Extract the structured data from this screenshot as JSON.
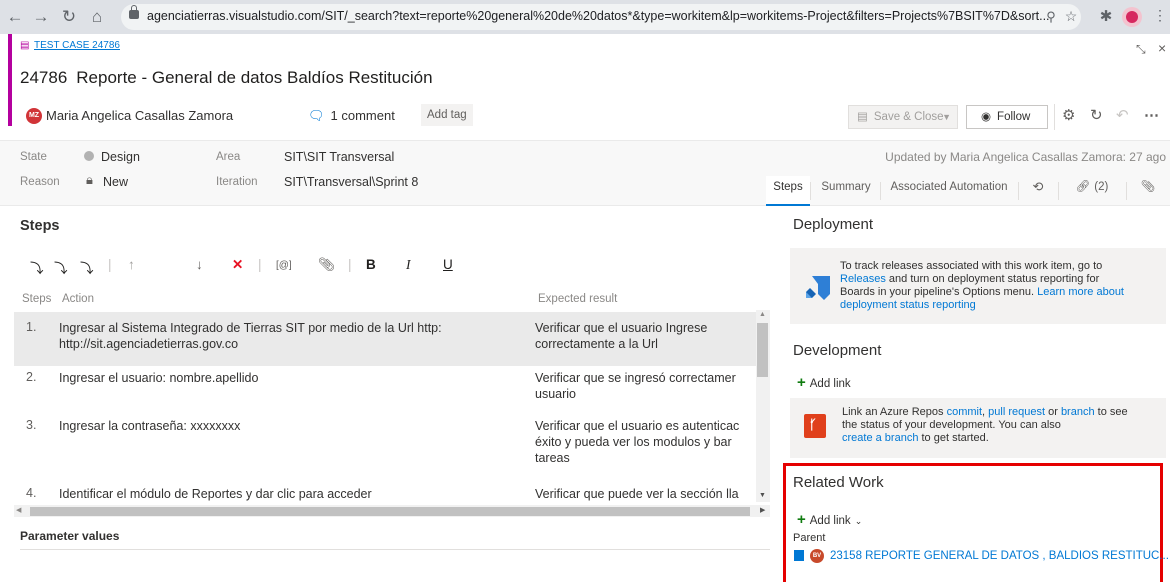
{
  "browser": {
    "url": "agenciatierras.visualstudio.com/SIT/_search?text=reporte%20general%20de%20datos*&type=workitem&lp=workitems-Project&filters=Projects%7BSIT%7D&sort..."
  },
  "workitem": {
    "breadcrumb": "TEST CASE 24786",
    "id": "24786",
    "title": "Reporte - General de datos Baldíos Restitución",
    "assignee": "Maria Angelica Casallas Zamora",
    "assignee_initials": "MZ",
    "comments": "1 comment",
    "add_tag": "Add tag"
  },
  "toolbar": {
    "save_close": "Save & Close",
    "follow": "Follow"
  },
  "fields": {
    "state_label": "State",
    "state_value": "Design",
    "reason_label": "Reason",
    "reason_value": "New",
    "area_label": "Area",
    "area_value": "SIT\\SIT Transversal",
    "iteration_label": "Iteration",
    "iteration_value": "SIT\\Transversal\\Sprint 8",
    "updated": "Updated by Maria Angelica Casallas Zamora: 27 ago"
  },
  "tabs": {
    "steps": "Steps",
    "summary": "Summary",
    "automation": "Associated Automation",
    "links": "(2)"
  },
  "steps": {
    "header": "Steps",
    "col_steps": "Steps",
    "col_action": "Action",
    "col_expected": "Expected result",
    "rows": [
      {
        "n": "1.",
        "action_1": "Ingresar al Sistema Integrado de Tierras SIT por medio de la Url http:",
        "action_2": "http://sit.agenciadetierras.gov.co",
        "exp_1": "Verificar que el usuario Ingrese",
        "exp_2": "correctamente a la Url",
        "exp_3": ""
      },
      {
        "n": "2.",
        "action_1": "Ingresar el usuario: nombre.apellido",
        "action_2": "",
        "exp_1": "Verificar que se ingresó correctamer",
        "exp_2": "usuario",
        "exp_3": ""
      },
      {
        "n": "3.",
        "action_1": "Ingresar la contraseña: xxxxxxxx",
        "action_2": "",
        "exp_1": "Verificar que el usuario es autenticac",
        "exp_2": "éxito y pueda ver los modulos y  bar",
        "exp_3": "tareas"
      },
      {
        "n": "4.",
        "action_1": "Identificar el módulo de Reportes y dar clic para acceder",
        "action_2": "",
        "exp_1": "Verificar que puede ver la sección lla",
        "exp_2": "",
        "exp_3": ""
      }
    ],
    "param_values": "Parameter values"
  },
  "deployment": {
    "title": "Deployment",
    "t1": "To track releases associated with this work item, go to",
    "t2a": "Releases",
    "t2b": " and turn on deployment status reporting for",
    "t3a": "Boards in your pipeline's Options menu. ",
    "t3b": "Learn more about",
    "t4": "deployment status reporting"
  },
  "development": {
    "title": "Development",
    "add_link": "Add link",
    "t1a": "Link an Azure Repos ",
    "t1b": "commit",
    "t1c": ", ",
    "t1d": "pull request",
    "t1e": " or ",
    "t1f": "branch",
    "t1g": " to see",
    "t2": "the status of your development. You can also",
    "t3a": "create a branch",
    "t3b": " to get started."
  },
  "related": {
    "title": "Related Work",
    "add_link": "Add link",
    "parent_label": "Parent",
    "parent_initials": "BV",
    "parent_item": "23158 REPORTE GENERAL DE DATOS , BALDIOS RESTITUC..."
  },
  "colors": {
    "accent": "#0078d4",
    "testcase_bar": "#b4009e",
    "highlight": "#e50000"
  }
}
